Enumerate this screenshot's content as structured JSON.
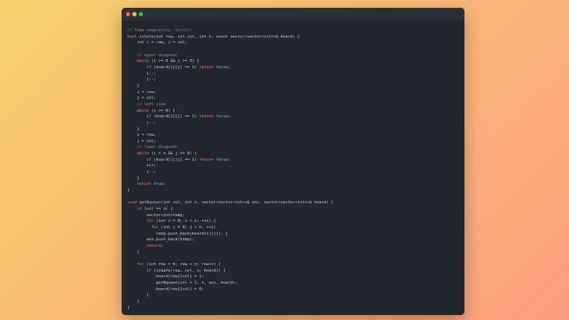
{
  "window": {
    "controls": {
      "close_color": "#fe5f57",
      "minimize_color": "#febc2e",
      "maximize_color": "#28c840"
    }
  },
  "code": {
    "lines": [
      [
        {
          "t": "cm",
          "v": "// Time complexity: O(n(n))"
        }
      ],
      [
        {
          "t": "kw",
          "v": "bool "
        },
        {
          "t": "fn",
          "v": "isSafe"
        },
        {
          "t": "",
          "v": "(int row, int col, int n, const vector<vector<int>>& board) {"
        }
      ],
      [
        {
          "t": "",
          "v": "    int i = row, j = col;"
        }
      ],
      [
        {
          "t": "",
          "v": ""
        }
      ],
      [
        {
          "t": "cm",
          "v": "    // upper diagonal"
        }
      ],
      [
        {
          "t": "kw",
          "v": "    while "
        },
        {
          "t": "",
          "v": "(i >= 0 && j >= 0) {"
        }
      ],
      [
        {
          "t": "kw",
          "v": "        if "
        },
        {
          "t": "",
          "v": "(board[i][j] == 1) "
        },
        {
          "t": "kw",
          "v": "return "
        },
        {
          "t": "bool",
          "v": "false"
        },
        {
          "t": "",
          "v": ";"
        }
      ],
      [
        {
          "t": "",
          "v": "        i--;"
        }
      ],
      [
        {
          "t": "",
          "v": "        j--;"
        }
      ],
      [
        {
          "t": "",
          "v": "    }"
        }
      ],
      [
        {
          "t": "",
          "v": "    i = row;"
        }
      ],
      [
        {
          "t": "",
          "v": "    j = col;"
        }
      ],
      [
        {
          "t": "cm",
          "v": "    // left side"
        }
      ],
      [
        {
          "t": "kw",
          "v": "    while "
        },
        {
          "t": "",
          "v": "(j >= 0) {"
        }
      ],
      [
        {
          "t": "kw",
          "v": "        if "
        },
        {
          "t": "",
          "v": "(board[i][j] == 1) "
        },
        {
          "t": "kw",
          "v": "return "
        },
        {
          "t": "bool",
          "v": "false"
        },
        {
          "t": "",
          "v": ";"
        }
      ],
      [
        {
          "t": "",
          "v": "        j--;"
        }
      ],
      [
        {
          "t": "",
          "v": "    }"
        }
      ],
      [
        {
          "t": "",
          "v": "    i = row;"
        }
      ],
      [
        {
          "t": "",
          "v": "    j = col;"
        }
      ],
      [
        {
          "t": "cm",
          "v": "    // lower diagonal"
        }
      ],
      [
        {
          "t": "kw",
          "v": "    while "
        },
        {
          "t": "",
          "v": "(i < n && j >= 0) {"
        }
      ],
      [
        {
          "t": "kw",
          "v": "        if "
        },
        {
          "t": "",
          "v": "(board[i][j] == 1) "
        },
        {
          "t": "kw",
          "v": "return "
        },
        {
          "t": "bool",
          "v": "false"
        },
        {
          "t": "",
          "v": ";"
        }
      ],
      [
        {
          "t": "",
          "v": "        i++;"
        }
      ],
      [
        {
          "t": "",
          "v": "        j--;"
        }
      ],
      [
        {
          "t": "",
          "v": "    }"
        }
      ],
      [
        {
          "t": "kw",
          "v": "    return "
        },
        {
          "t": "bool",
          "v": "true"
        },
        {
          "t": "",
          "v": ";"
        }
      ],
      [
        {
          "t": "",
          "v": "}"
        }
      ],
      [
        {
          "t": "",
          "v": ""
        }
      ],
      [
        {
          "t": "kw",
          "v": "void "
        },
        {
          "t": "fn",
          "v": "getNqueen"
        },
        {
          "t": "",
          "v": "(int col, int n, vector<vector<int>>& ans, vector<vector<int>>& board) {"
        }
      ],
      [
        {
          "t": "kw",
          "v": "    if "
        },
        {
          "t": "",
          "v": "(col == n) {"
        }
      ],
      [
        {
          "t": "",
          "v": "        vector<int>temp;"
        }
      ],
      [
        {
          "t": "kw",
          "v": "        for "
        },
        {
          "t": "",
          "v": "(int i = 0; i < n; ++i) {"
        }
      ],
      [
        {
          "t": "kw",
          "v": "          for "
        },
        {
          "t": "",
          "v": "(int j = 0; j < n; ++j)"
        }
      ],
      [
        {
          "t": "",
          "v": "            temp.push_back(board[i][j]); }"
        }
      ],
      [
        {
          "t": "",
          "v": "        ans.push_back(temp);"
        }
      ],
      [
        {
          "t": "kw",
          "v": "        return"
        },
        {
          "t": "",
          "v": ";"
        }
      ],
      [
        {
          "t": "",
          "v": "    }"
        }
      ],
      [
        {
          "t": "",
          "v": ""
        }
      ],
      [
        {
          "t": "kw",
          "v": "    for "
        },
        {
          "t": "",
          "v": "(int row = 0; row < n; row++) {"
        }
      ],
      [
        {
          "t": "kw",
          "v": "        if "
        },
        {
          "t": "",
          "v": "(isSafe(row, col, n, board)) {"
        }
      ],
      [
        {
          "t": "",
          "v": "            board[row][col] = 1;"
        }
      ],
      [
        {
          "t": "",
          "v": "            getNqueen(col + 1, n, ans, board);"
        }
      ],
      [
        {
          "t": "",
          "v": "            board[row][col] = 0;"
        }
      ],
      [
        {
          "t": "",
          "v": "        }"
        }
      ],
      [
        {
          "t": "",
          "v": "    }"
        }
      ],
      [
        {
          "t": "",
          "v": "}"
        }
      ]
    ]
  }
}
